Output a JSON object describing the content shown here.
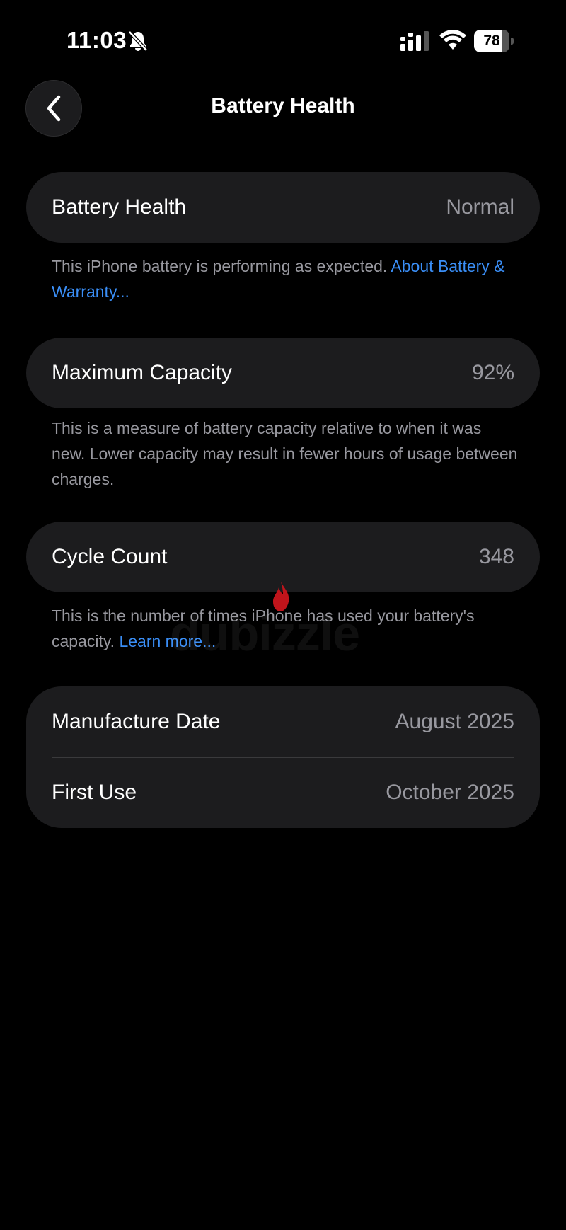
{
  "status_bar": {
    "time": "11:03",
    "battery_level": "78",
    "battery_fraction": 0.78,
    "icons": [
      "bell-slash-icon",
      "cellular-signal-icon",
      "wifi-icon",
      "battery-icon"
    ]
  },
  "nav": {
    "back_icon": "chevron-left-icon",
    "title": "Battery Health"
  },
  "battery_health": {
    "label": "Battery Health",
    "value": "Normal",
    "footnote": "This iPhone battery is performing as expected.",
    "footnote_link": "About Battery & Warranty..."
  },
  "maximum_capacity": {
    "label": "Maximum Capacity",
    "value": "92%",
    "footnote": "This is a measure of battery capacity relative to when it was new. Lower capacity may result in fewer hours of usage between charges."
  },
  "cycle_count": {
    "label": "Cycle Count",
    "value": "348",
    "footnote": "This is the number of times iPhone has used your battery's capacity.",
    "footnote_link": "Learn more..."
  },
  "dates": {
    "manufacture_label": "Manufacture Date",
    "manufacture_value": "August 2025",
    "first_use_label": "First Use",
    "first_use_value": "October 2025"
  },
  "watermark": "dubizzle",
  "colors": {
    "background": "#000000",
    "card": "#1c1c1e",
    "secondary_text": "#98989f",
    "link": "#3a8ef6"
  }
}
